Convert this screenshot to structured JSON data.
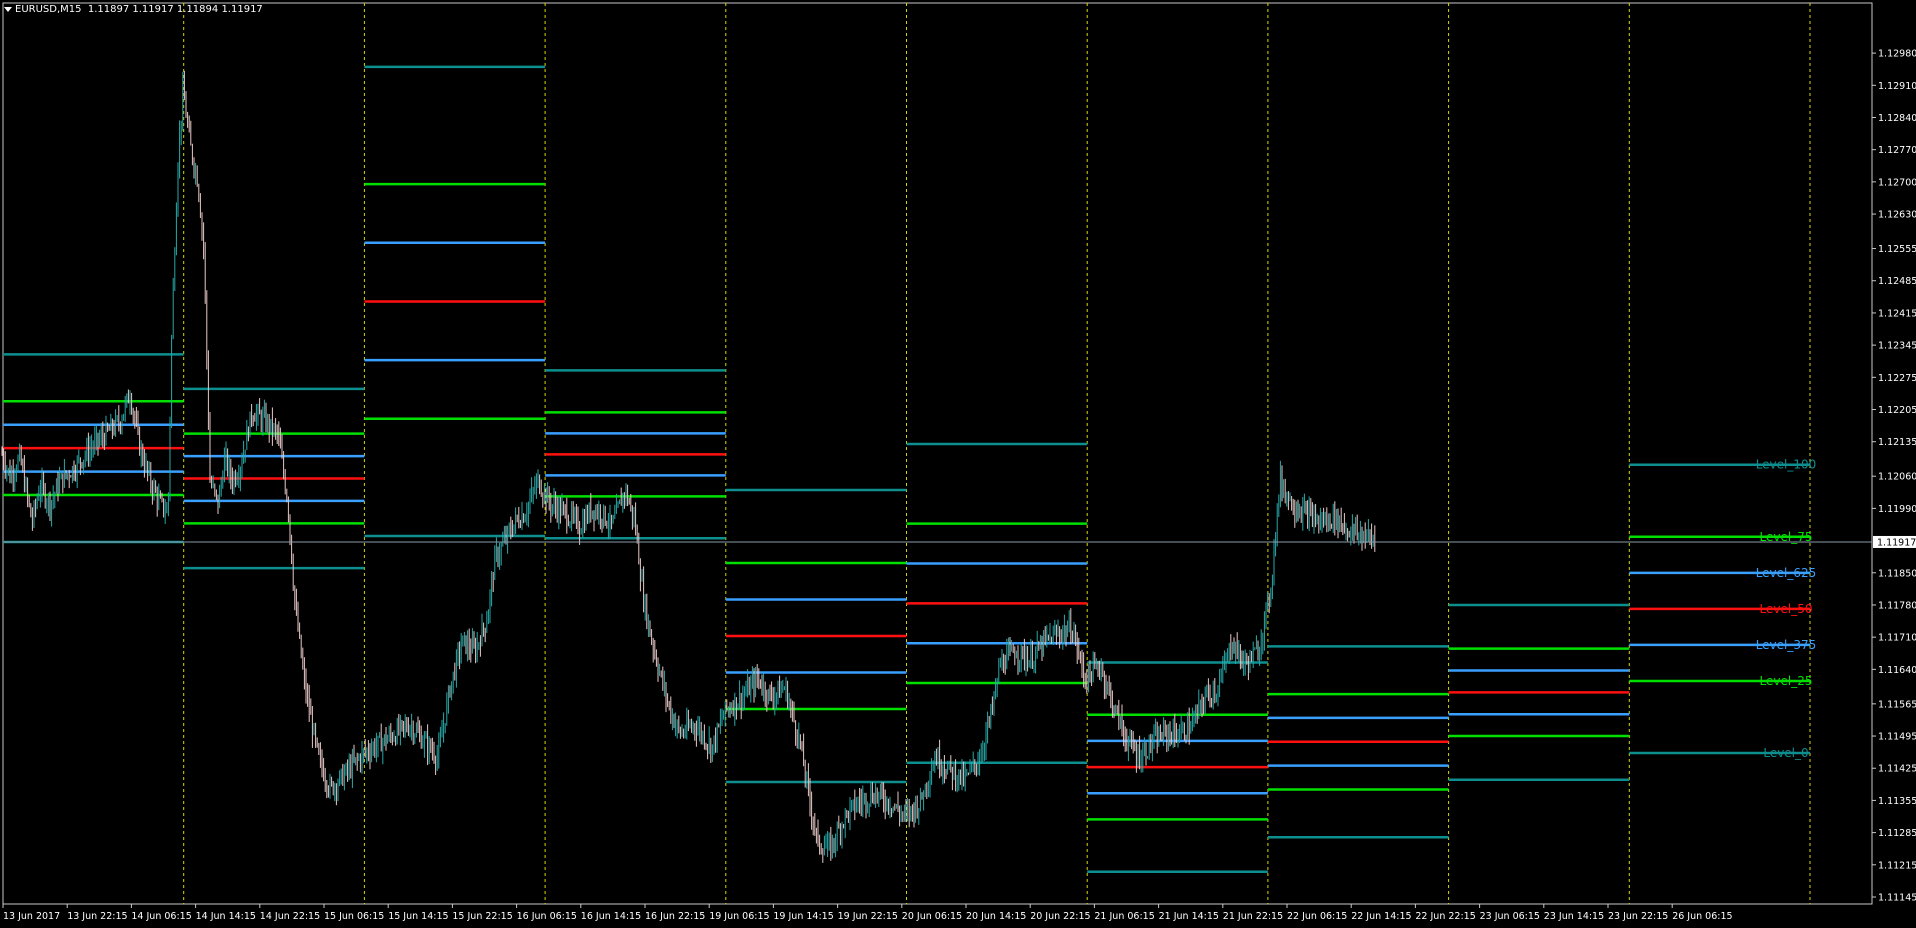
{
  "header": {
    "symbol": "EURUSD,M15",
    "ohlc": "1.11897 1.11917 1.11894 1.11917"
  },
  "colors": {
    "background": "#000000",
    "frame": "#c8c8c8",
    "separator": "#d8d800",
    "bull": "#2aa9a9",
    "bear": "#e8c8c8",
    "level_0": "#0e8f8f",
    "level_25": "#00e000",
    "level_375": "#3aa0ff",
    "level_50": "#ff1010",
    "price_line": "#8a9aaa"
  },
  "chart_data": {
    "type": "candlestick",
    "title": "",
    "ylim": [
      1.11145,
      1.13015
    ],
    "y_ticks": [
      "1.12980",
      "1.12910",
      "1.12840",
      "1.12770",
      "1.12700",
      "1.12630",
      "1.12555",
      "1.12485",
      "1.12415",
      "1.12345",
      "1.12275",
      "1.12205",
      "1.12135",
      "1.12060",
      "1.11990",
      "1.11917",
      "1.11850",
      "1.11780",
      "1.11710",
      "1.11640",
      "1.11565",
      "1.11495",
      "1.11425",
      "1.11355",
      "1.11285",
      "1.11215",
      "1.11145"
    ],
    "x_ticks": [
      "13 Jun 2017",
      "13 Jun 22:15",
      "14 Jun 06:15",
      "14 Jun 14:15",
      "14 Jun 22:15",
      "15 Jun 06:15",
      "15 Jun 14:15",
      "15 Jun 22:15",
      "16 Jun 06:15",
      "16 Jun 14:15",
      "16 Jun 22:15",
      "19 Jun 06:15",
      "19 Jun 14:15",
      "19 Jun 22:15",
      "20 Jun 06:15",
      "20 Jun 14:15",
      "20 Jun 22:15",
      "21 Jun 06:15",
      "21 Jun 14:15",
      "21 Jun 22:15",
      "22 Jun 06:15",
      "22 Jun 14:15",
      "22 Jun 22:15",
      "23 Jun 06:15",
      "23 Jun 14:15",
      "23 Jun 22:15",
      "26 Jun 06:15"
    ],
    "current_price": "1.11917",
    "segments": [
      {
        "top": 1.12325,
        "bottom": 1.11917
      },
      {
        "top": 1.1225,
        "bottom": 1.1186
      },
      {
        "top": 1.1295,
        "bottom": 1.1193
      },
      {
        "top": 1.1229,
        "bottom": 1.11925
      },
      {
        "top": 1.1203,
        "bottom": 1.11395
      },
      {
        "top": 1.1213,
        "bottom": 1.11437
      },
      {
        "top": 1.11655,
        "bottom": 1.112
      },
      {
        "top": 1.1169,
        "bottom": 1.11275
      },
      {
        "top": 1.1178,
        "bottom": 1.114
      },
      {
        "top": 1.12085,
        "bottom": 1.11458
      }
    ],
    "level_labels": [
      "Level_100",
      "Level_75",
      "Level_625",
      "Level_50",
      "Level_375",
      "Level_25",
      "Level_0"
    ],
    "series": [
      {
        "values": [
          [
            0,
            1.1212
          ],
          [
            10,
            1.1206
          ],
          [
            20,
            1.121
          ],
          [
            32,
            1.1196
          ],
          [
            40,
            1.1204
          ],
          [
            50,
            1.12
          ],
          [
            60,
            1.1205
          ],
          [
            75,
            1.1208
          ],
          [
            90,
            1.1212
          ],
          [
            105,
            1.1215
          ],
          [
            120,
            1.1218
          ],
          [
            130,
            1.1224
          ],
          [
            140,
            1.1212
          ],
          [
            150,
            1.1205
          ],
          [
            160,
            1.12
          ],
          [
            168,
            1.1198
          ],
          [
            172,
            1.124
          ],
          [
            178,
            1.1275
          ],
          [
            183,
            1.129
          ],
          [
            190,
            1.1278
          ],
          [
            198,
            1.127
          ],
          [
            204,
            1.1255
          ],
          [
            210,
            1.1205
          ],
          [
            218,
            1.12
          ],
          [
            225,
            1.121
          ],
          [
            232,
            1.1205
          ],
          [
            240,
            1.1208
          ],
          [
            252,
            1.122
          ],
          [
            265,
            1.1218
          ],
          [
            278,
            1.1215
          ],
          [
            288,
            1.12
          ],
          [
            295,
            1.1178
          ],
          [
            305,
            1.116
          ],
          [
            318,
            1.1145
          ],
          [
            330,
            1.1138
          ],
          [
            340,
            1.114
          ],
          [
            352,
            1.1143
          ],
          [
            365,
            1.1146
          ],
          [
            380,
            1.1148
          ],
          [
            395,
            1.115
          ],
          [
            410,
            1.1152
          ],
          [
            425,
            1.1148
          ],
          [
            438,
            1.1145
          ],
          [
            450,
            1.116
          ],
          [
            462,
            1.117
          ],
          [
            475,
            1.1168
          ],
          [
            487,
            1.1175
          ],
          [
            495,
            1.1188
          ],
          [
            505,
            1.1192
          ],
          [
            515,
            1.1196
          ],
          [
            525,
            1.1198
          ],
          [
            538,
            1.1205
          ],
          [
            550,
            1.12
          ],
          [
            565,
            1.1198
          ],
          [
            580,
            1.1195
          ],
          [
            592,
            1.1199
          ],
          [
            602,
            1.1198
          ],
          [
            612,
            1.1195
          ],
          [
            625,
            1.1203
          ],
          [
            635,
            1.1196
          ],
          [
            643,
            1.118
          ],
          [
            650,
            1.1172
          ],
          [
            660,
            1.1163
          ],
          [
            670,
            1.1155
          ],
          [
            680,
            1.115
          ],
          [
            695,
            1.1152
          ],
          [
            712,
            1.1147
          ],
          [
            725,
            1.1155
          ],
          [
            742,
            1.1158
          ],
          [
            758,
            1.1162
          ],
          [
            770,
            1.1158
          ],
          [
            785,
            1.116
          ],
          [
            800,
            1.1148
          ],
          [
            810,
            1.1135
          ],
          [
            818,
            1.1126
          ],
          [
            830,
            1.1125
          ],
          [
            845,
            1.1132
          ],
          [
            858,
            1.1135
          ],
          [
            875,
            1.1137
          ],
          [
            890,
            1.1135
          ],
          [
            905,
            1.1132
          ],
          [
            920,
            1.1135
          ],
          [
            935,
            1.1145
          ],
          [
            950,
            1.1142
          ],
          [
            965,
            1.114
          ],
          [
            980,
            1.1145
          ],
          [
            992,
            1.1155
          ],
          [
            1000,
            1.1165
          ],
          [
            1015,
            1.1168
          ],
          [
            1030,
            1.1166
          ],
          [
            1045,
            1.117
          ],
          [
            1060,
            1.1172
          ],
          [
            1072,
            1.1173
          ],
          [
            1085,
            1.1162
          ],
          [
            1100,
            1.1165
          ],
          [
            1115,
            1.1155
          ],
          [
            1128,
            1.1148
          ],
          [
            1140,
            1.1145
          ],
          [
            1152,
            1.1148
          ],
          [
            1165,
            1.115
          ],
          [
            1180,
            1.115
          ],
          [
            1192,
            1.1152
          ],
          [
            1205,
            1.1158
          ],
          [
            1218,
            1.116
          ],
          [
            1232,
            1.117
          ],
          [
            1245,
            1.1165
          ],
          [
            1258,
            1.1168
          ],
          [
            1270,
            1.118
          ],
          [
            1280,
            1.1205
          ],
          [
            1292,
            1.12
          ],
          [
            1305,
            1.1198
          ],
          [
            1320,
            1.1196
          ],
          [
            1335,
            1.1197
          ],
          [
            1350,
            1.1194
          ],
          [
            1365,
            1.1193
          ],
          [
            1375,
            1.1192
          ]
        ]
      }
    ]
  }
}
